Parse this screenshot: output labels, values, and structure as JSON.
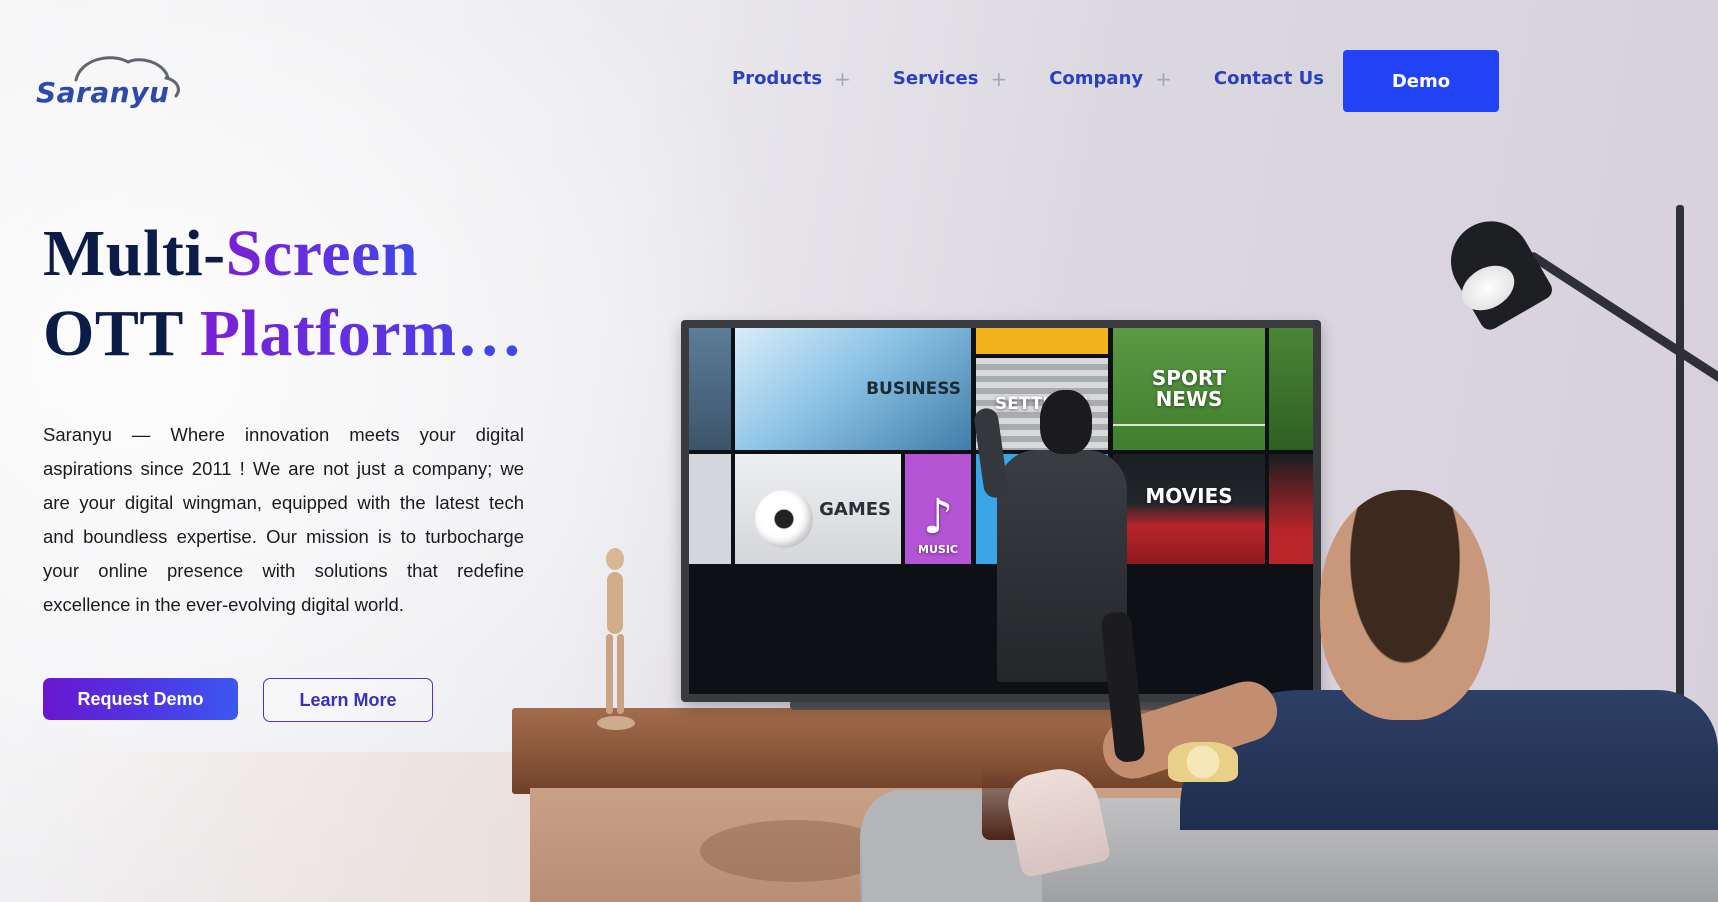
{
  "brand": {
    "logo_text": "Saranyu"
  },
  "nav": {
    "items": [
      {
        "label": "Products",
        "expandable": true
      },
      {
        "label": "Services",
        "expandable": true
      },
      {
        "label": "Company",
        "expandable": true
      },
      {
        "label": "Contact Us",
        "expandable": false
      }
    ],
    "demo_label": "Demo",
    "plus_glyph": "+"
  },
  "hero": {
    "title_line1_a": "Multi-",
    "title_line1_b": "Screen",
    "title_line2_a": "OTT ",
    "title_line2_b": "Platform…",
    "description": "Saranyu — Where innovation meets your digital aspirations since 2011 ! We are not just a company; we are your digital wingman, equipped with the latest tech and boundless expertise. Our mission is to turbocharge your online presence with solutions that redefine excellence in the ever-evolving digital world.",
    "primary_button": "Request Demo",
    "secondary_button": "Learn More"
  },
  "tv_tiles": {
    "business": "BUSINESS",
    "settings": "SETTINGS",
    "sport_line1": "SPORT",
    "sport_line2": "NEWS",
    "games": "GAMES",
    "music": "MUSIC",
    "music_icon": "♪",
    "movies": "MOVIES"
  },
  "colors": {
    "brand_blue": "#2142f5",
    "nav_text": "#2b3fc0",
    "title_dark": "#0b1d47",
    "gradient_purple": "#6a17cf",
    "gradient_blue": "#3c57f0"
  }
}
